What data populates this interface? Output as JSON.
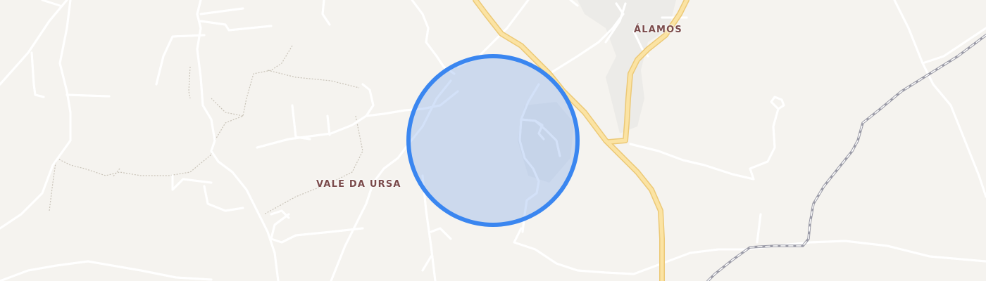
{
  "map": {
    "places": {
      "alamos": "ÁLAMOS",
      "vale_da_ursa": "VALE DA URSA"
    },
    "colors": {
      "background": "#f5f3ef",
      "minor_road": "#ffffff",
      "road_casing": "#e4e0da",
      "main_road": "#fbe3a3",
      "main_road_casing": "#ecc977",
      "railway": "#9a9aa6",
      "track": "#c9c3b8",
      "built_area": "#ecebe8",
      "location_fill": "rgba(130,170,235,0.35)",
      "location_stroke": "#3a86f0",
      "label": "#7a4a4a"
    },
    "features": {
      "location_circle": "location-accuracy-circle",
      "railway": "railway-line",
      "main_road": "main-road"
    }
  }
}
